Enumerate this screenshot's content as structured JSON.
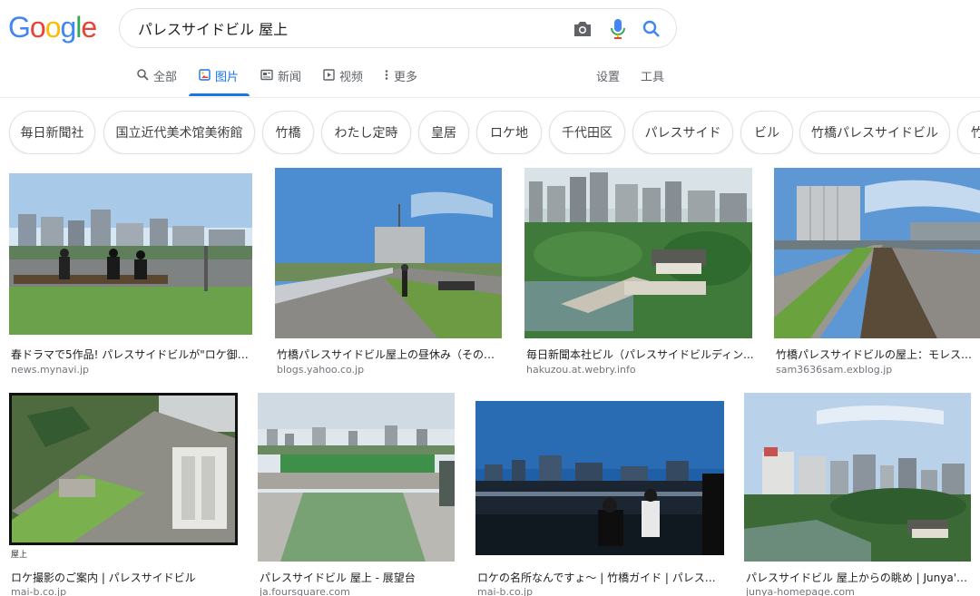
{
  "logo_text": "Google",
  "search": {
    "query": "パレスサイドビル 屋上"
  },
  "icons": {
    "camera": "camera-icon",
    "mic": "microphone-icon",
    "search": "search-icon"
  },
  "tabs": [
    {
      "label": "全部",
      "icon": "search-icon"
    },
    {
      "label": "图片",
      "icon": "image-icon"
    },
    {
      "label": "新闻",
      "icon": "news-icon"
    },
    {
      "label": "视频",
      "icon": "video-icon"
    },
    {
      "label": "更多",
      "icon": "more-dots-icon"
    }
  ],
  "settings_label": "设置",
  "tools_label": "工具",
  "chips": [
    "毎日新聞社",
    "国立近代美术馆美術館",
    "竹橋",
    "わたし定時",
    "皇居",
    "ロケ地",
    "千代田区",
    "パレスサイド",
    "ビル",
    "竹橋パレスサイドビル",
    "竹"
  ],
  "results": [
    {
      "title": "春ドラマで5作品! パレスサイドビルが\"ロケ御用...",
      "source": "news.mynavi.jp",
      "image": "rooftop-people-on-bench"
    },
    {
      "title": "竹橋パレスサイドビル屋上の昼休み（その他...",
      "source": "blogs.yahoo.co.jp",
      "image": "rooftop-walkway-tower"
    },
    {
      "title": "毎日新聞本社ビル（パレスサイドビルディン...",
      "source": "hakuzou.at.webry.info",
      "image": "imperial-palace-view"
    },
    {
      "title": "竹橋パレスサイドビルの屋上：モレスビな!",
      "source": "sam3636sam.exblog.jp",
      "image": "rooftop-grass-tower"
    },
    {
      "title": "ロケ撮影のご案内 | パレスサイドビル",
      "source": "mai-b.co.jp",
      "image": "aerial-rooftop",
      "caption": "屋上"
    },
    {
      "title": "パレスサイドビル 屋上 - 展望台",
      "source": "ja.foursquare.com",
      "image": "rooftop-deck"
    },
    {
      "title": "ロケの名所なんですょ～ | 竹橋ガイド | パレスサ...",
      "source": "mai-b.co.jp",
      "image": "drama-scene-rooftop"
    },
    {
      "title": "パレスサイドビル 屋上からの眺め | Junya's ...",
      "source": "junya-homepage.com",
      "image": "city-skyline-moat"
    }
  ],
  "colors": {
    "accent": "#1a73e8",
    "g_blue": "#4285F4",
    "g_red": "#EA4335",
    "g_yellow": "#FBBC05",
    "g_green": "#34A853"
  }
}
